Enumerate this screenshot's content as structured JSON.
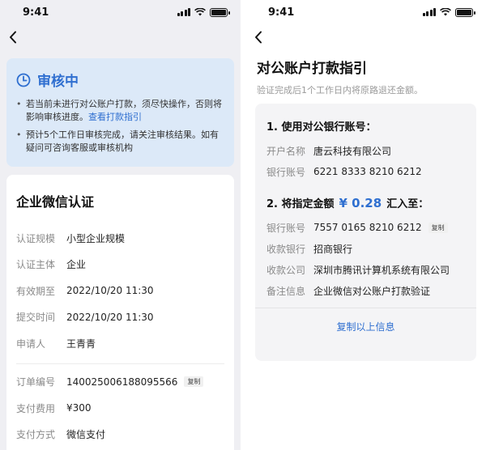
{
  "left": {
    "status": {
      "time": "9:41"
    },
    "notice": {
      "title": "审核中",
      "item1_text": "若当前未进行对公账户打款，须尽快操作，否则将影响审核进度。",
      "item1_link": "查看打款指引",
      "item2_text": "预计5个工作日审核完成，请关注审核结果。如有疑问可咨询客服或审核机构"
    },
    "card": {
      "title": "企业微信认证",
      "rows": [
        {
          "k": "认证规模",
          "v": "小型企业规模"
        },
        {
          "k": "认证主体",
          "v": "企业"
        },
        {
          "k": "有效期至",
          "v": "2022/10/20 11:30"
        },
        {
          "k": "提交时间",
          "v": "2022/10/20 11:30"
        },
        {
          "k": "申请人",
          "v": "王青青"
        }
      ],
      "order": {
        "k": "订单编号",
        "v": "140025006188095566",
        "copy": "复制"
      },
      "fee": {
        "k": "支付费用",
        "v": "¥300"
      },
      "method": {
        "k": "支付方式",
        "v": "微信支付"
      }
    }
  },
  "right": {
    "status": {
      "time": "9:41"
    },
    "title": "对公账户打款指引",
    "subtitle": "验证完成后1个工作日内将原路退还金额。",
    "step1": {
      "title": "1. 使用对公银行账号：",
      "rows": [
        {
          "k": "开户名称",
          "v": "唐云科技有限公司"
        },
        {
          "k": "银行账号",
          "v": "6221 8333 8210 6212"
        }
      ]
    },
    "step2": {
      "prefix": "2. 将指定金额",
      "amount": "¥ 0.28",
      "suffix": "汇入至：",
      "account": {
        "k": "银行账号",
        "v": "7557 0165 8210 6212",
        "copy": "复制"
      },
      "rows": [
        {
          "k": "收款银行",
          "v": "招商银行"
        },
        {
          "k": "收款公司",
          "v": "深圳市腾讯计算机系统有限公司"
        },
        {
          "k": "备注信息",
          "v": "企业微信对公账户打款验证"
        }
      ]
    },
    "copy_all": "复制以上信息"
  },
  "colors": {
    "accent": "#2f6fd0",
    "notice_bg": "#dce9f8",
    "page_bg": "#efeff3"
  }
}
